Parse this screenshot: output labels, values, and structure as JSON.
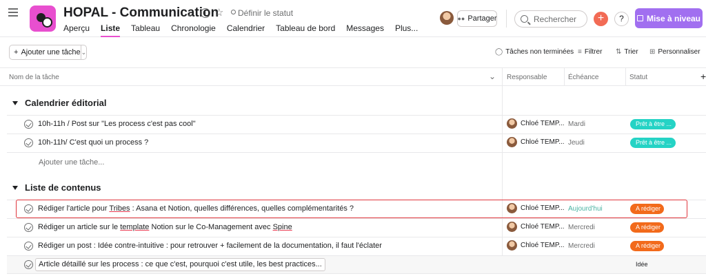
{
  "header": {
    "project_title": "HOPAL - Communication",
    "status_label": "Définir le statut",
    "tabs": [
      {
        "label": "Aperçu",
        "active": false
      },
      {
        "label": "Liste",
        "active": true
      },
      {
        "label": "Tableau",
        "active": false
      },
      {
        "label": "Chronologie",
        "active": false
      },
      {
        "label": "Calendrier",
        "active": false
      },
      {
        "label": "Tableau de bord",
        "active": false
      },
      {
        "label": "Messages",
        "active": false
      },
      {
        "label": "Plus...",
        "active": false
      }
    ],
    "share_label": "Partager",
    "search_placeholder": "Rechercher",
    "upgrade_label": "Mise à niveau",
    "help_label": "?",
    "plus_label": "+",
    "accent_color": "#e84fcf",
    "upgrade_color": "#a16ff0"
  },
  "toolbar": {
    "add_task_label": "Ajouter une tâche",
    "incomplete_label": "Tâches non terminées",
    "filter_label": "Filtrer",
    "sort_label": "Trier",
    "customize_label": "Personnaliser"
  },
  "columns": {
    "name": "Nom de la tâche",
    "assignee": "Responsable",
    "due": "Échéance",
    "status": "Statut"
  },
  "sections": [
    {
      "title": "Calendrier éditorial",
      "add_task_label": "Ajouter une tâche...",
      "tasks": [
        {
          "name": "10h-11h / Post sur \"Les process c'est pas cool\"",
          "assignee": "Chloé TEMP...",
          "due": "Mardi",
          "status": "Prêt à être ..."
        },
        {
          "name": "10h-11h/ C'est quoi un process ?",
          "assignee": "Chloé TEMP...",
          "due": "Jeudi",
          "status": "Prêt à être ..."
        }
      ]
    },
    {
      "title": "Liste de contenus",
      "tasks": [
        {
          "name_before": "Rédiger l'article pour ",
          "name_link": "Tribes",
          "name_after": " : Asana et Notion, quelles différences, quelles complémentarités ?",
          "assignee": "Chloé TEMP...",
          "due": "Aujourd'hui",
          "status": "A rédiger"
        },
        {
          "name_before": "Rédiger un article sur le ",
          "name_link": "template",
          "name_mid": " Notion sur le Co-Management avec ",
          "name_link2": "Spine",
          "assignee": "Chloé TEMP...",
          "due": "Mercredi",
          "status": "A rédiger"
        },
        {
          "name": "Rédiger un post : Idée contre-intuitive : pour retrouver + facilement de la documentation, il faut l'éclater",
          "assignee": "Chloé TEMP...",
          "due": "Mercredi",
          "status": "A rédiger"
        },
        {
          "name": "Article détaillé sur les process : ce que c'est, pourquoi c'est utile, les best practices...",
          "assignee": "",
          "due": "",
          "status": "Idée"
        }
      ]
    }
  ],
  "status_colors": {
    "ready": "#25d3c5",
    "to_write": "#f26a1b"
  }
}
